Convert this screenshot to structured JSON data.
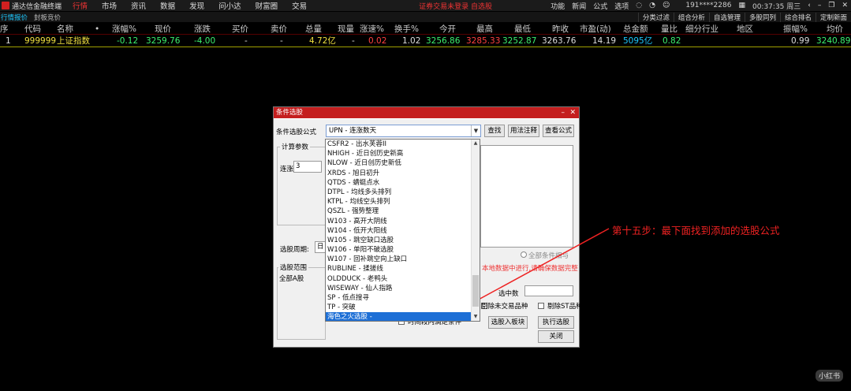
{
  "menubar": {
    "app_name": "通达信金融终端",
    "items": [
      "行情",
      "市场",
      "资讯",
      "数据",
      "发现",
      "问小达",
      "财富圈",
      "交易"
    ],
    "notice": "证券交易未登录  自选股",
    "right_items": [
      "功能",
      "新闻",
      "公式",
      "选项"
    ],
    "user": "191****2286",
    "time": "00:37:35 周三"
  },
  "toolbar2": {
    "tabs": [
      "行情报价",
      "封板竞价"
    ],
    "right_buttons": [
      "分类过滤",
      "组合分析",
      "自选管理",
      "多股同列",
      "综合排名",
      "定制新面"
    ]
  },
  "table": {
    "headers": [
      "序",
      "代码",
      "名称",
      "•",
      "涨幅%",
      "现价",
      "涨跌",
      "买价",
      "卖价",
      "总量",
      "现量",
      "涨速%",
      "换手%",
      "今开",
      "最高",
      "最低",
      "昨收",
      "市盈(动)",
      "总金额",
      "量比",
      "细分行业",
      "地区",
      "振幅%",
      "均价"
    ],
    "row": {
      "idx": "1",
      "code": "999999",
      "name": "上证指数",
      "change_pct": "-0.12",
      "price": "3259.76",
      "change": "-4.00",
      "bid": "-",
      "ask": "-",
      "volume": "4.72亿",
      "cur_vol": "-",
      "speed": "0.02",
      "turnover": "1.02",
      "open": "3256.86",
      "high": "3285.33",
      "low": "3252.87",
      "prev_close": "3263.76",
      "pe": "14.19",
      "amount": "5095亿",
      "vol_ratio": "0.82",
      "amplitude": "0.99",
      "avg_price": "3240.89"
    }
  },
  "dialog": {
    "title": "条件选股",
    "formula_label": "条件选股公式",
    "formula_value": "UPN  -  连涨数天",
    "btn_find": "查找",
    "btn_usage": "用法注释",
    "btn_view": "查看公式",
    "params_group": "计算参数",
    "param_label": "连涨",
    "param_value": "3",
    "period_label": "选股周期:",
    "period_value": "日",
    "range_group": "选股范围",
    "range_value": "全部A股",
    "fragment_label": "",
    "fragment_msg": "本地数据中进行,请确保数据完整",
    "selected_count_label": "选中数",
    "radio_label": "全部条件相与",
    "cb_prelist": "剔除未交易品种",
    "cb_st": "剔除ST品种",
    "cb_time": "时间段内满足条件",
    "btn_add_block": "选股入板块",
    "btn_exec": "执行选股",
    "btn_close": "关闭",
    "list_items": [
      "CSFR2  -  出水芙蓉II",
      "NHIGH  -  近日创历史新高",
      "NLOW  -  近日创历史新低",
      "XRDS  -  旭日初升",
      "QTDS  -  蜻蜓点水",
      "DTPL  -  均线多头排列",
      "KTPL  -  均线空头排列",
      "QSZL  -  强势整理",
      "W103  -  高开大阴线",
      "W104  -  低开大阳线",
      "W105  -  跳空缺口选股",
      "W106  -  单阳不破选股",
      "W107  -  回补跳空向上缺口",
      "RUBLINE  -  揉搓线",
      "OLDDUCK  -  老鸭头",
      "WISEWAY  -  仙人指路",
      "SP  -  低点搜寻",
      "TP  -  突破",
      "海色之火选股  -"
    ],
    "selected_index": 18
  },
  "annotation": "第十五步：最下面找到添加的选股公式",
  "watermark": "小红书",
  "colors": {
    "up": "#ff4040",
    "down": "#3cf06e",
    "accent": "#1ec9ff",
    "dialog_title": "#c41e1e",
    "annotation": "#e22222"
  }
}
